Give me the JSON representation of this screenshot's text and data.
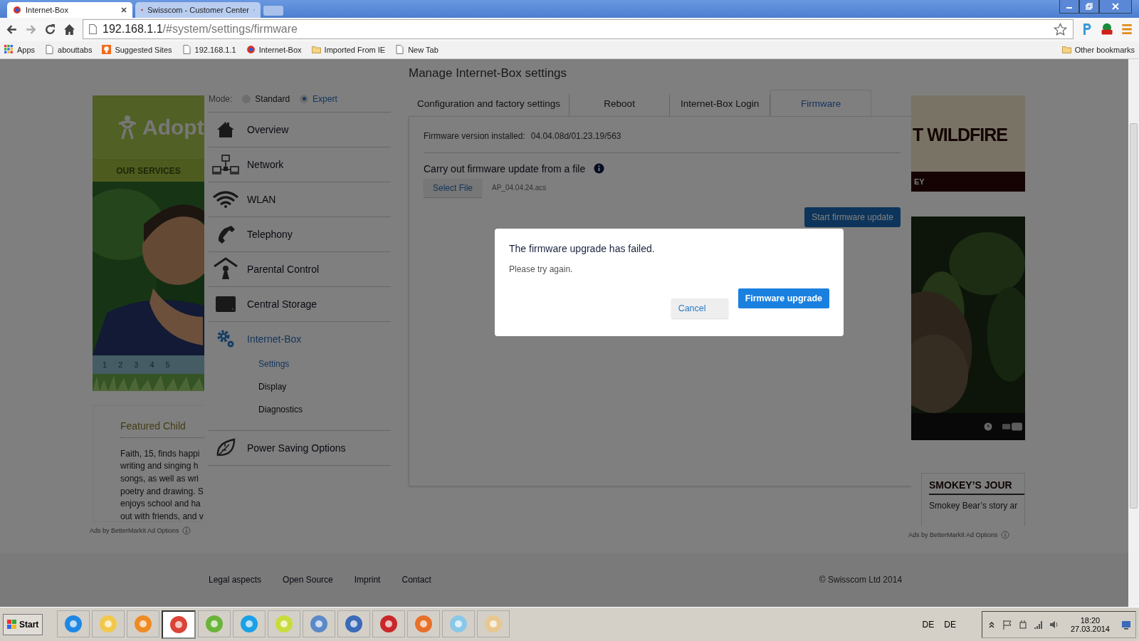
{
  "browser": {
    "tabs": [
      {
        "title": "Internet-Box",
        "selected": true
      },
      {
        "title": "Swisscom - Customer Center",
        "selected": false
      }
    ],
    "address": {
      "host": "192.168.1.1",
      "path": "/#system/settings/firmware"
    },
    "bookmarks": [
      {
        "label": "Apps",
        "kind": "apps"
      },
      {
        "label": "abouttabs",
        "kind": "page"
      },
      {
        "label": "Suggested Sites",
        "kind": "suggested"
      },
      {
        "label": "192.168.1.1",
        "kind": "page"
      },
      {
        "label": "Internet-Box",
        "kind": "site"
      },
      {
        "label": "Imported From IE",
        "kind": "folder"
      },
      {
        "label": "New Tab",
        "kind": "page"
      }
    ],
    "other_bookmarks": "Other bookmarks"
  },
  "page": {
    "heading": "Manage Internet-Box settings",
    "mode": {
      "label": "Mode:",
      "options": [
        {
          "label": "Standard",
          "selected": false
        },
        {
          "label": "Expert",
          "selected": true
        }
      ]
    },
    "nav": [
      {
        "label": "Overview",
        "kind": "home",
        "selected": false
      },
      {
        "label": "Network",
        "kind": "network",
        "selected": false
      },
      {
        "label": "WLAN",
        "kind": "wifi",
        "selected": false
      },
      {
        "label": "Telephony",
        "kind": "phone",
        "selected": false
      },
      {
        "label": "Parental Control",
        "kind": "parental",
        "selected": false
      },
      {
        "label": "Central Storage",
        "kind": "storage",
        "selected": false
      },
      {
        "label": "Internet-Box",
        "kind": "gears",
        "selected": true,
        "children": [
          {
            "label": "Settings",
            "selected": true
          },
          {
            "label": "Display",
            "selected": false
          },
          {
            "label": "Diagnostics",
            "selected": false
          }
        ]
      },
      {
        "label": "Power Saving Options",
        "kind": "leaf",
        "selected": false
      }
    ],
    "tabs": [
      {
        "label": "Configuration and factory settings",
        "selected": false
      },
      {
        "label": "Reboot",
        "selected": false
      },
      {
        "label": "Internet-Box Login",
        "selected": false
      },
      {
        "label": "Firmware",
        "selected": true
      }
    ],
    "firmware_version": {
      "label": "Firmware version installed:",
      "value": "04.04.08d/01.23.19/563"
    },
    "update": {
      "title": "Carry out firmware update from a file",
      "select_button": "Select File",
      "file_name": "AP_04.04.24.acs",
      "start_button": "Start firmware update"
    }
  },
  "dialog": {
    "title": "The firmware upgrade has failed.",
    "message": "Please try again.",
    "buttons": [
      {
        "label": "Cancel",
        "kind": "secondary"
      },
      {
        "label": "Firmware upgrade",
        "kind": "primary"
      }
    ]
  },
  "left_ad": {
    "logo": "Adopt",
    "band": "OUR SERVICES",
    "pages": [
      "1",
      "2",
      "3",
      "4",
      "5"
    ],
    "card_title": "Featured Child",
    "card_lines": [
      "Faith, 15, finds happi",
      "writing and singing h",
      "songs, as well as wri",
      "poetry and drawing. S",
      "enjoys school and ha",
      "out with friends, and v"
    ],
    "ads_label": "Ads by BetterMarkIt Ad Options"
  },
  "right_ad": {
    "headline": "T WILDFIRE",
    "band": "EY",
    "card_title": "SMOKEY’S JOUR",
    "card_text": "Smokey Bear’s story ar",
    "ads_label": "Ads by BetterMarkIt Ad Options"
  },
  "footer": {
    "links": [
      "Legal aspects",
      "Open Source",
      "Imprint",
      "Contact"
    ],
    "copyright": "© Swisscom Ltd 2014"
  },
  "taskbar": {
    "start": "Start",
    "apps": [
      {
        "kind": "ie",
        "selected": false
      },
      {
        "kind": "folder",
        "selected": false
      },
      {
        "kind": "media",
        "selected": false
      },
      {
        "kind": "chrome",
        "selected": true
      },
      {
        "kind": "torrent",
        "selected": false
      },
      {
        "kind": "skype",
        "selected": false
      },
      {
        "kind": "ruler",
        "selected": false
      },
      {
        "kind": "monitor",
        "selected": false
      },
      {
        "kind": "network",
        "selected": false
      },
      {
        "kind": "toolbox",
        "selected": false
      },
      {
        "kind": "firefox",
        "selected": false
      },
      {
        "kind": "notepad",
        "selected": false
      },
      {
        "kind": "paint",
        "selected": false
      }
    ],
    "languages": [
      "DE",
      "DE"
    ],
    "time": "18:20",
    "date": "27.03.2014"
  }
}
